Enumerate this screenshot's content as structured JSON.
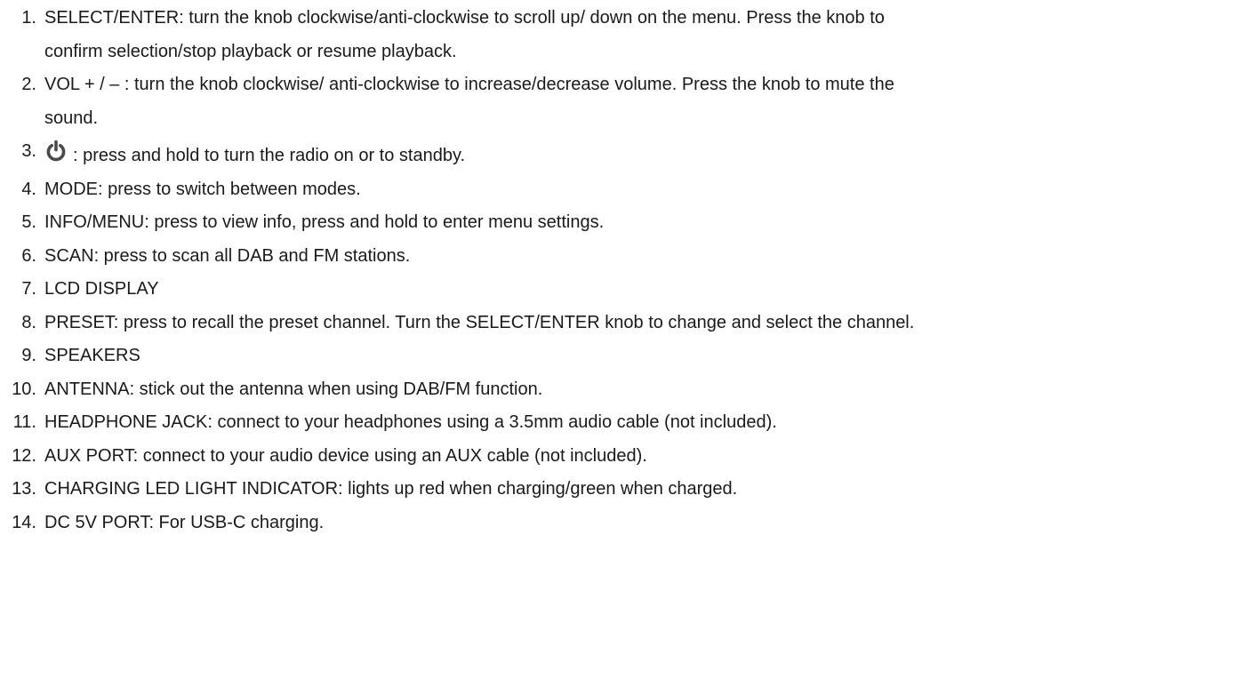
{
  "items": [
    {
      "number": "1.",
      "lines": [
        "SELECT/ENTER: turn the knob clockwise/anti-clockwise to scroll up/ down on the menu. Press the knob to",
        "confirm selection/stop playback or resume playback."
      ]
    },
    {
      "number": "2.",
      "lines": [
        "VOL + / – : turn the knob clockwise/ anti-clockwise to increase/decrease volume. Press the knob to mute the",
        "sound."
      ]
    },
    {
      "number": "3.",
      "icon": "power-icon",
      "text": ": press and hold to turn the radio on or to standby."
    },
    {
      "number": "4.",
      "text": "MODE: press to switch between modes."
    },
    {
      "number": "5.",
      "text": "INFO/MENU: press to view info, press and hold to enter menu settings."
    },
    {
      "number": "6.",
      "text": "SCAN: press to scan all DAB and FM stations."
    },
    {
      "number": "7.",
      "text": "LCD DISPLAY"
    },
    {
      "number": "8.",
      "text": "PRESET: press to recall the preset channel. Turn the SELECT/ENTER knob to change and select the channel."
    },
    {
      "number": "9.",
      "text": "SPEAKERS"
    },
    {
      "number": "10.",
      "text": "ANTENNA: stick out the antenna when using DAB/FM function."
    },
    {
      "number": "11.",
      "text": "HEADPHONE JACK: connect to your headphones using a 3.5mm audio cable (not included)."
    },
    {
      "number": "12.",
      "text": "AUX PORT: connect to your audio device using an AUX cable (not included)."
    },
    {
      "number": "13.",
      "text": "CHARGING LED LIGHT INDICATOR: lights up red when charging/green when charged."
    },
    {
      "number": "14.",
      "text": "DC 5V PORT: For USB-C charging."
    }
  ]
}
